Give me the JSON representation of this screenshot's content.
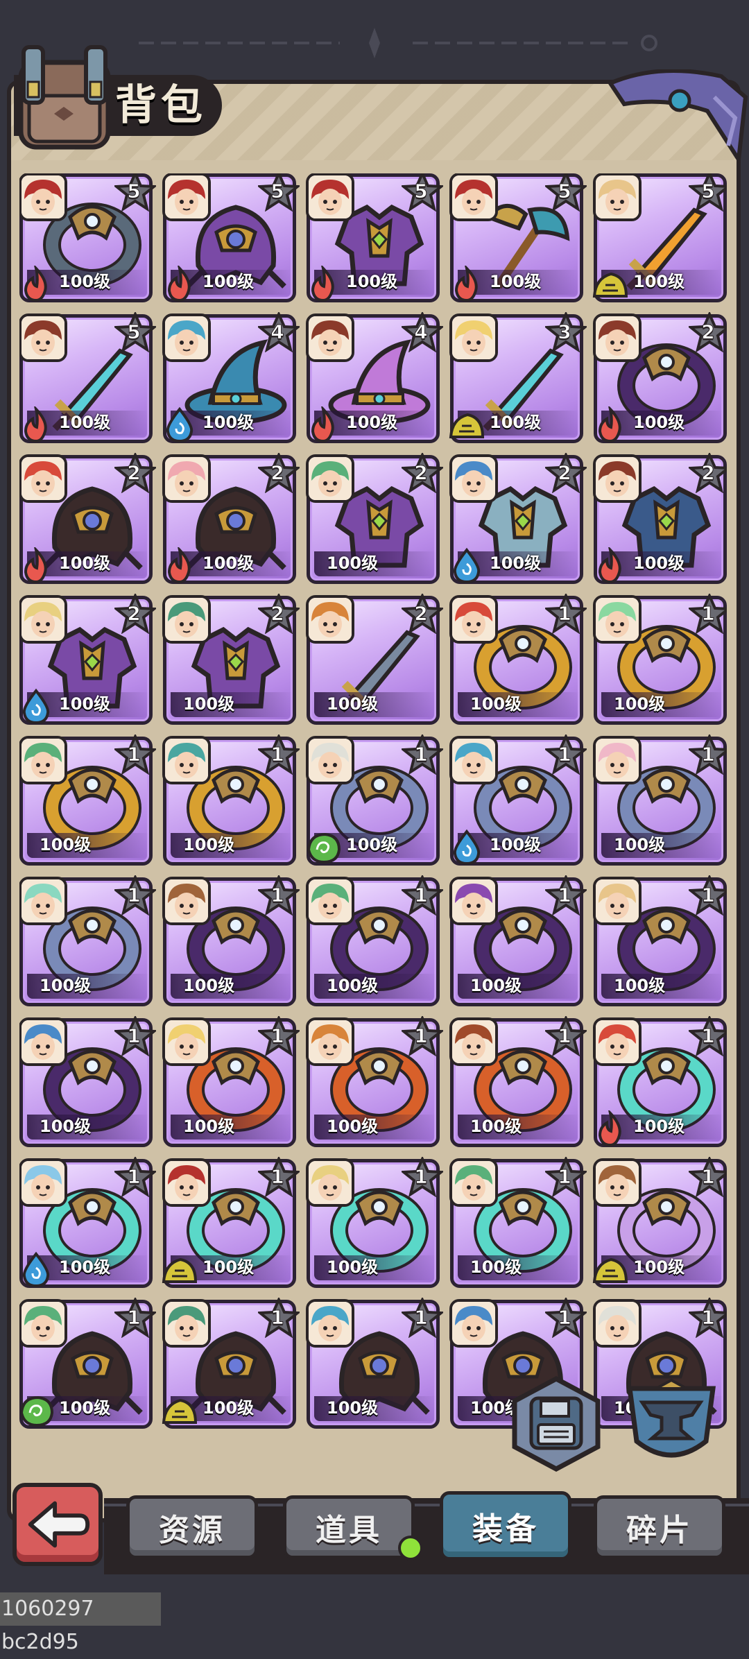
{
  "header": {
    "title": "背包"
  },
  "tabs": [
    {
      "label": "资源",
      "active": false
    },
    {
      "label": "道具",
      "active": false,
      "notification": true
    },
    {
      "label": "装备",
      "active": true
    },
    {
      "label": "碎片",
      "active": false
    }
  ],
  "colors": {
    "fire": "#e8584f",
    "water": "#3d9bd9",
    "earth": "#d6c53a",
    "wind": "#5cb84a",
    "card_bg": "#c79cf2",
    "active_tab": "#4a7e98"
  },
  "items": [
    {
      "star": "5",
      "level": "100级",
      "element": "fire",
      "gear": "ring",
      "gear_color": "#5a6a7a",
      "avatar": "#b5322e"
    },
    {
      "star": "5",
      "level": "100级",
      "element": "fire",
      "gear": "helm",
      "gear_color": "#7a4aa6",
      "avatar": "#b5322e"
    },
    {
      "star": "5",
      "level": "100级",
      "element": "fire",
      "gear": "armor",
      "gear_color": "#7a4aa6",
      "avatar": "#b5322e"
    },
    {
      "star": "5",
      "level": "100级",
      "element": "fire",
      "gear": "axe",
      "gear_color": "#3d9bb0",
      "avatar": "#b5322e"
    },
    {
      "star": "5",
      "level": "100级",
      "element": "earth",
      "gear": "sword",
      "gear_color": "#f0a030",
      "avatar": "#e8c58a"
    },
    {
      "star": "5",
      "level": "100级",
      "element": "fire",
      "gear": "sword",
      "gear_color": "#5ad0d8",
      "avatar": "#8b3a2a"
    },
    {
      "star": "4",
      "level": "100级",
      "element": "water",
      "gear": "hat",
      "gear_color": "#3a8ab0",
      "avatar": "#4aa6c8"
    },
    {
      "star": "4",
      "level": "100级",
      "element": "fire",
      "gear": "hat",
      "gear_color": "#c07ad8",
      "avatar": "#8b3a2a"
    },
    {
      "star": "3",
      "level": "100级",
      "element": "earth",
      "gear": "sword",
      "gear_color": "#5ad0d8",
      "avatar": "#f0d070"
    },
    {
      "star": "2",
      "level": "100级",
      "element": "fire",
      "gear": "ring",
      "gear_color": "#4a2a6a",
      "avatar": "#8b3a2a"
    },
    {
      "star": "2",
      "level": "100级",
      "element": "fire",
      "gear": "helm",
      "gear_color": "#3a2a2a",
      "avatar": "#d84a3a"
    },
    {
      "star": "2",
      "level": "100级",
      "element": "fire",
      "gear": "helm",
      "gear_color": "#3a2a2a",
      "avatar": "#f0a8b0"
    },
    {
      "star": "2",
      "level": "100级",
      "element": "",
      "gear": "armor",
      "gear_color": "#7a4aa6",
      "avatar": "#5ab07a"
    },
    {
      "star": "2",
      "level": "100级",
      "element": "water",
      "gear": "armor",
      "gear_color": "#8ab0c0",
      "avatar": "#4a8ac8"
    },
    {
      "star": "2",
      "level": "100级",
      "element": "fire",
      "gear": "armor",
      "gear_color": "#3a5a8a",
      "avatar": "#8b3a2a"
    },
    {
      "star": "2",
      "level": "100级",
      "element": "water",
      "gear": "armor",
      "gear_color": "#7a4aa6",
      "avatar": "#e8d080"
    },
    {
      "star": "2",
      "level": "100级",
      "element": "",
      "gear": "armor",
      "gear_color": "#7a4aa6",
      "avatar": "#4a9a7a"
    },
    {
      "star": "2",
      "level": "100级",
      "element": "",
      "gear": "sword",
      "gear_color": "#7a8aa0",
      "avatar": "#d8843a"
    },
    {
      "star": "1",
      "level": "100级",
      "element": "",
      "gear": "ring",
      "gear_color": "#d8a030",
      "avatar": "#d84a3a"
    },
    {
      "star": "1",
      "level": "100级",
      "element": "",
      "gear": "ring",
      "gear_color": "#d8a030",
      "avatar": "#8ad8a0"
    },
    {
      "star": "1",
      "level": "100级",
      "element": "",
      "gear": "ring",
      "gear_color": "#d8a030",
      "avatar": "#5ab07a"
    },
    {
      "star": "1",
      "level": "100级",
      "element": "",
      "gear": "ring",
      "gear_color": "#d8a030",
      "avatar": "#4aa6a0"
    },
    {
      "star": "1",
      "level": "100级",
      "element": "wind",
      "gear": "ring",
      "gear_color": "#7a8ab8",
      "avatar": "#e0e0d8"
    },
    {
      "star": "1",
      "level": "100级",
      "element": "water",
      "gear": "ring",
      "gear_color": "#7a8ab8",
      "avatar": "#4aa6c8"
    },
    {
      "star": "1",
      "level": "100级",
      "element": "",
      "gear": "ring",
      "gear_color": "#7a8ab8",
      "avatar": "#f0b8c8"
    },
    {
      "star": "1",
      "level": "100级",
      "element": "",
      "gear": "ring",
      "gear_color": "#7a8ab8",
      "avatar": "#8ad8c0"
    },
    {
      "star": "1",
      "level": "100级",
      "element": "",
      "gear": "ring",
      "gear_color": "#4a2a6a",
      "avatar": "#a0643a"
    },
    {
      "star": "1",
      "level": "100级",
      "element": "",
      "gear": "ring",
      "gear_color": "#4a2a6a",
      "avatar": "#5ab07a"
    },
    {
      "star": "1",
      "level": "100级",
      "element": "",
      "gear": "ring",
      "gear_color": "#4a2a6a",
      "avatar": "#8a4ab0"
    },
    {
      "star": "1",
      "level": "100级",
      "element": "",
      "gear": "ring",
      "gear_color": "#4a2a6a",
      "avatar": "#e8c58a"
    },
    {
      "star": "1",
      "level": "100级",
      "element": "",
      "gear": "ring",
      "gear_color": "#4a2a6a",
      "avatar": "#4a8ac8"
    },
    {
      "star": "1",
      "level": "100级",
      "element": "",
      "gear": "ring",
      "gear_color": "#d8602a",
      "avatar": "#f0d070"
    },
    {
      "star": "1",
      "level": "100级",
      "element": "",
      "gear": "ring",
      "gear_color": "#d8602a",
      "avatar": "#d8843a"
    },
    {
      "star": "1",
      "level": "100级",
      "element": "",
      "gear": "ring",
      "gear_color": "#d8602a",
      "avatar": "#a04a2a"
    },
    {
      "star": "1",
      "level": "100级",
      "element": "fire",
      "gear": "ring",
      "gear_color": "#5ad8c8",
      "avatar": "#d84a3a"
    },
    {
      "star": "1",
      "level": "100级",
      "element": "water",
      "gear": "ring",
      "gear_color": "#5ad8c8",
      "avatar": "#8ac8e8"
    },
    {
      "star": "1",
      "level": "100级",
      "element": "earth",
      "gear": "ring",
      "gear_color": "#5ad8c8",
      "avatar": "#b5322e"
    },
    {
      "star": "1",
      "level": "100级",
      "element": "",
      "gear": "ring",
      "gear_color": "#5ad8c8",
      "avatar": "#e8d080"
    },
    {
      "star": "1",
      "level": "100级",
      "element": "",
      "gear": "ring",
      "gear_color": "#5ad8c8",
      "avatar": "#5ab07a"
    },
    {
      "star": "1",
      "level": "100级",
      "element": "earth",
      "gear": "ring",
      "gear_color": "#c8a0e8",
      "avatar": "#a0643a"
    },
    {
      "star": "1",
      "level": "100级",
      "element": "wind",
      "gear": "helm",
      "gear_color": "#3a2a2a",
      "avatar": "#5ab07a"
    },
    {
      "star": "1",
      "level": "100级",
      "element": "earth",
      "gear": "helm",
      "gear_color": "#3a2a2a",
      "avatar": "#4a9a7a"
    },
    {
      "star": "1",
      "level": "100级",
      "element": "",
      "gear": "helm",
      "gear_color": "#3a2a2a",
      "avatar": "#4aa6c8"
    },
    {
      "star": "1",
      "level": "100级",
      "element": "",
      "gear": "helm",
      "gear_color": "#3a2a2a",
      "avatar": "#4a8ac8"
    },
    {
      "star": "1",
      "level": "100级",
      "element": "",
      "gear": "helm",
      "gear_color": "#3a2a2a",
      "avatar": "#e0e0d8"
    }
  ],
  "buttons": {
    "save_icon": "floppy-disk-icon",
    "forge_icon": "anvil-icon",
    "back_icon": "back-arrow-icon"
  },
  "footer": {
    "debug_id": "1060297 bc2d95"
  }
}
